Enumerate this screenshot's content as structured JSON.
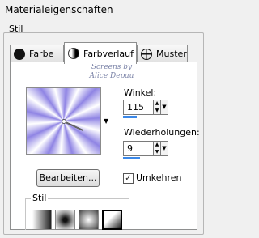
{
  "window": {
    "title": "Materialeigenschaften"
  },
  "section": {
    "label": "Stil"
  },
  "tabs": [
    {
      "label": "Farbe",
      "icon": "solid-color-icon",
      "active": false
    },
    {
      "label": "Farbverlauf",
      "icon": "gradient-icon",
      "active": true
    },
    {
      "label": "Muster",
      "icon": "pattern-icon",
      "active": false
    }
  ],
  "watermark": {
    "line1": "Screens by",
    "line2": "Alice Depau"
  },
  "gradient": {
    "colors": [
      "#ffffff",
      "#8f84e4"
    ]
  },
  "angle": {
    "label": "Winkel:",
    "value": "115"
  },
  "repeats": {
    "label": "Wiederholungen:",
    "value": "9"
  },
  "edit_button": {
    "label": "Bearbeiten..."
  },
  "invert": {
    "label": "Umkehren",
    "checked": true,
    "mark": "✓"
  },
  "style_group": {
    "label": "Stil",
    "options": [
      "linear",
      "rectangular",
      "sunburst",
      "radial"
    ],
    "selected": "radial"
  }
}
